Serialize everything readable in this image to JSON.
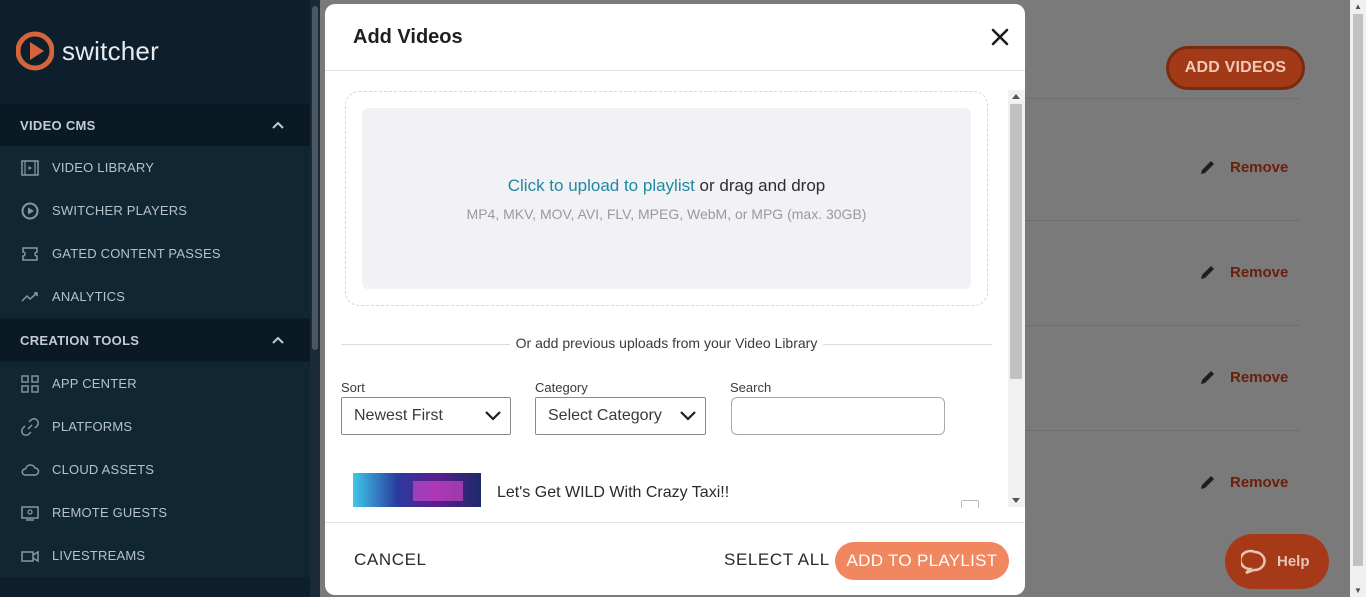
{
  "sidebar": {
    "brand": "switcher",
    "sections": [
      {
        "title": "VIDEO CMS",
        "items": [
          {
            "label": "VIDEO LIBRARY",
            "icon": "film-icon"
          },
          {
            "label": "SWITCHER PLAYERS",
            "icon": "player-logo-icon"
          },
          {
            "label": "GATED CONTENT PASSES",
            "icon": "ticket-icon"
          },
          {
            "label": "ANALYTICS",
            "icon": "trend-icon"
          }
        ]
      },
      {
        "title": "CREATION TOOLS",
        "items": [
          {
            "label": "APP CENTER",
            "icon": "grid-icon"
          },
          {
            "label": "PLATFORMS",
            "icon": "link-icon"
          },
          {
            "label": "CLOUD ASSETS",
            "icon": "cloud-icon"
          },
          {
            "label": "REMOTE GUESTS",
            "icon": "remote-icon"
          },
          {
            "label": "LIVESTREAMS",
            "icon": "camera-icon"
          }
        ]
      }
    ]
  },
  "background": {
    "add_videos_label": "ADD VIDEOS",
    "remove_label": "Remove",
    "help_label": "Help"
  },
  "modal": {
    "title": "Add Videos",
    "upload": {
      "link_text": "Click to upload to playlist",
      "rest_text": " or drag and drop",
      "formats": "MP4, MKV, MOV, AVI, FLV, MPEG, WebM, or MPG (max. 30GB)"
    },
    "library_divider": "Or add previous uploads from your Video Library",
    "filters": {
      "sort_label": "Sort",
      "sort_value": "Newest First",
      "category_label": "Category",
      "category_value": "Select Category",
      "search_label": "Search",
      "search_value": ""
    },
    "videos": [
      {
        "title": "Let's Get WILD With Crazy Taxi!!"
      }
    ],
    "footer": {
      "cancel": "CANCEL",
      "select_all": "SELECT ALL",
      "add_to_playlist": "ADD TO PLAYLIST"
    }
  },
  "colors": {
    "accent": "#f0875e",
    "link": "#1e8aa0",
    "sidebar_bg": "#0d1f2c"
  }
}
